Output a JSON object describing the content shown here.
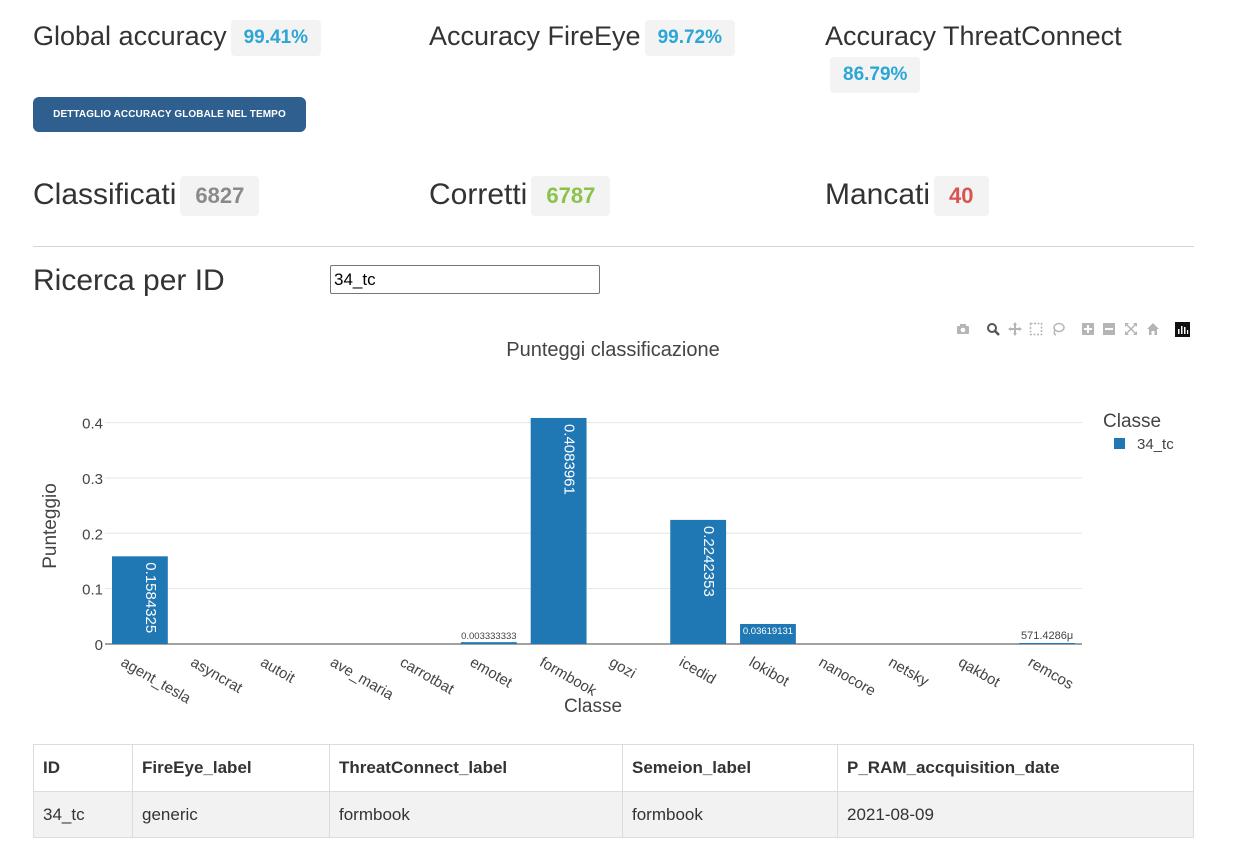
{
  "stats": {
    "global_label": "Global accuracy",
    "global_value": "99.41%",
    "fireeye_label": "Accuracy FireEye",
    "fireeye_value": "99.72%",
    "tc_label": "Accuracy ThreatConnect",
    "tc_value": "86.79%",
    "classificati_label": "Classificati",
    "classificati_value": "6827",
    "corretti_label": "Corretti",
    "corretti_value": "6787",
    "mancati_label": "Mancati",
    "mancati_value": "40"
  },
  "button_label": "DETTAGLIO ACCURACY GLOBALE NEL TEMPO",
  "search": {
    "label": "Ricerca per ID",
    "value": "34_tc"
  },
  "modebar_icons": [
    "camera-icon",
    "zoom-icon",
    "pan-icon",
    "box-select-icon",
    "lasso-icon",
    "zoom-in-icon",
    "zoom-out-icon",
    "autoscale-icon",
    "home-icon",
    "plotly-logo-icon"
  ],
  "chart_data": {
    "type": "bar",
    "title": "Punteggi classificazione",
    "xlabel": "Classe",
    "ylabel": "Punteggio",
    "ylim": [
      0,
      0.43
    ],
    "yticks": [
      "0",
      "0.1",
      "0.2",
      "0.3",
      "0.4"
    ],
    "grid": true,
    "legend_title": "Classe",
    "legend_position": "top-right",
    "categories": [
      "agent_tesla",
      "asyncrat",
      "autoit",
      "ave_maria",
      "carrotbat",
      "emotet",
      "formbook",
      "gozi",
      "icedid",
      "lokibot",
      "nanocore",
      "netsky",
      "qakbot",
      "remcos"
    ],
    "series": [
      {
        "name": "34_tc",
        "color": "#1f77b4",
        "values": [
          0.1584325,
          0,
          0,
          0,
          0,
          0.003333333,
          0.4083961,
          0,
          0.2242353,
          0.03619131,
          0,
          0,
          0,
          0.0005714286
        ],
        "labels": [
          "0.1584325",
          "",
          "",
          "",
          "",
          "0.003333333",
          "0.4083961",
          "",
          "0.2242353",
          "0.03619131",
          "",
          "",
          "",
          "571.4286μ"
        ]
      }
    ]
  },
  "table": {
    "headers": [
      "ID",
      "FireEye_label",
      "ThreatConnect_label",
      "Semeion_label",
      "P_RAM_accquisition_date"
    ],
    "rows": [
      [
        "34_tc",
        "generic",
        "formbook",
        "formbook",
        "2021-08-09"
      ]
    ]
  }
}
